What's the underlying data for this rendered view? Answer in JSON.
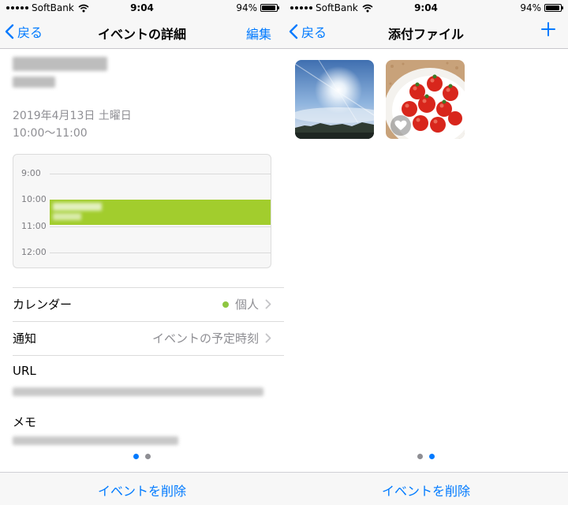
{
  "left": {
    "status": {
      "carrier": "SoftBank",
      "time": "9:04",
      "battery": "94%",
      "battery_level": 0.94
    },
    "nav": {
      "back_label": "戻る",
      "title": "イベントの詳細",
      "action_label": "編集"
    },
    "event": {
      "date": "2019年4月13日 土曜日",
      "time_range": "10:00〜11:00",
      "timeline_hours": [
        "9:00",
        "10:00",
        "11:00",
        "12:00"
      ],
      "event_color": "#a2cd2d"
    },
    "rows": {
      "calendar_label": "カレンダー",
      "calendar_value": "個人",
      "calendar_color": "#8ec641",
      "alert_label": "通知",
      "alert_value": "イベントの予定時刻",
      "url_label": "URL",
      "memo_label": "メモ"
    },
    "delete_label": "イベントを削除"
  },
  "right": {
    "status": {
      "carrier": "SoftBank",
      "time": "9:04",
      "battery": "94%",
      "battery_level": 0.94
    },
    "nav": {
      "back_label": "戻る",
      "title": "添付ファイル"
    },
    "delete_label": "イベントを削除"
  },
  "colors": {
    "accent": "#007aff"
  }
}
